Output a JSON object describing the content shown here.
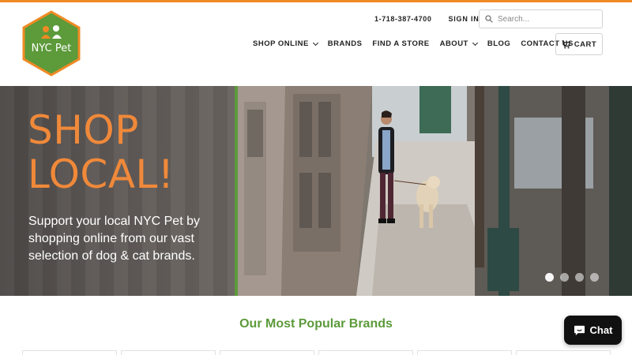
{
  "header": {
    "logo_text": "NYC Pet",
    "phone": "1-718-387-4700",
    "signin_label": "SIGN IN",
    "search": {
      "placeholder": "Search..."
    },
    "nav": [
      {
        "label": "SHOP ONLINE",
        "dropdown": true
      },
      {
        "label": "BRANDS",
        "dropdown": false
      },
      {
        "label": "FIND A STORE",
        "dropdown": false
      },
      {
        "label": "ABOUT",
        "dropdown": true
      },
      {
        "label": "BLOG",
        "dropdown": false
      },
      {
        "label": "CONTACT US",
        "dropdown": false
      }
    ],
    "cart_label": "CART"
  },
  "hero": {
    "title_line1": "SHOP",
    "title_line2": "LOCAL!",
    "subtitle": "Support your local NYC Pet by shopping online from our vast selection of dog & cat brands.",
    "slide_count": 4,
    "active_slide": 1
  },
  "popular": {
    "title": "Our Most Popular Brands",
    "card_count": 6
  },
  "chat": {
    "label": "Chat"
  },
  "colors": {
    "accent_orange": "#f08a24",
    "brand_green": "#5c9a3a",
    "hero_title": "#f0893a"
  },
  "icons": [
    "search-icon",
    "chevron-down-icon",
    "cart-icon",
    "chat-bubble-icon"
  ]
}
